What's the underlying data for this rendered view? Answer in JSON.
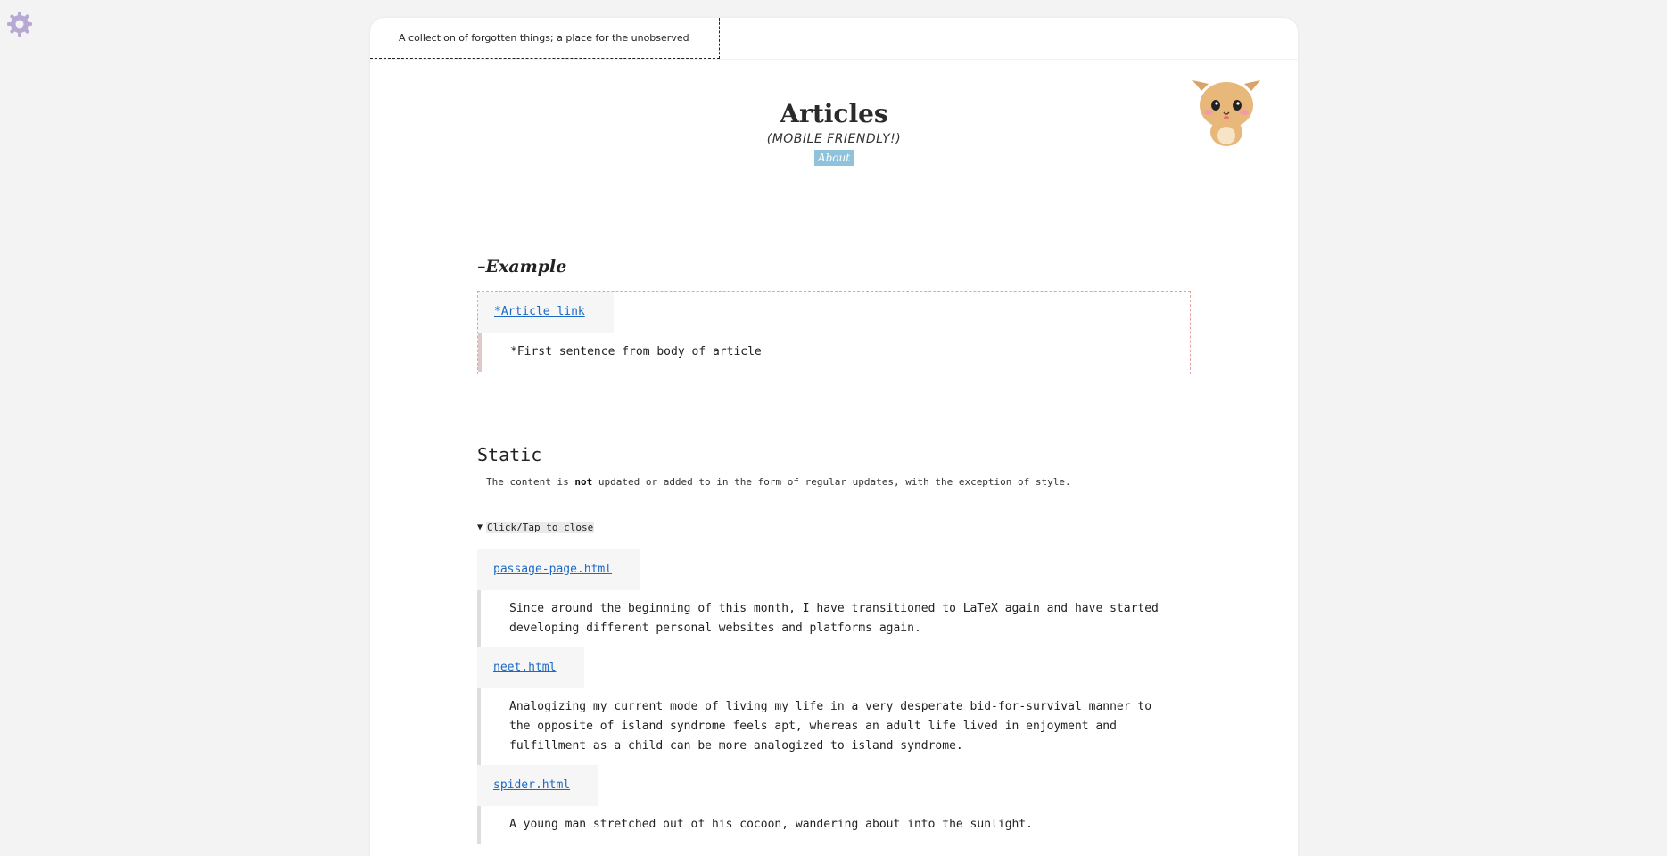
{
  "tagline": "A collection of forgotten things; a place for the unobserved",
  "header": {
    "title": "Articles",
    "subtitle": "(MOBILE FRIENDLY!)",
    "about_label": "About"
  },
  "example": {
    "heading": "–Example",
    "link_label": "*Article link",
    "first_sentence": "*First sentence from body of article"
  },
  "static": {
    "heading": "Static",
    "desc_before": "The content is",
    "desc_bold": "not",
    "desc_after": "updated or added to in the form of regular updates, with the exception of style.",
    "toggle_label": "Click/Tap to close"
  },
  "articles": [
    {
      "link": "passage-page.html",
      "excerpt": "Since around the beginning of this month, I have transitioned to LaTeX again and have started developing different personal websites and platforms again."
    },
    {
      "link": "neet.html",
      "excerpt": "Analogizing my current mode of living my life in a very desperate bid-for-survival manner to the opposite of island syndrome feels apt, whereas an adult life lived in enjoyment and fulfillment as a child can be more analogized to island syndrome."
    },
    {
      "link": "spider.html",
      "excerpt": "A young man stretched out of his cocoon, wandering about into the sunlight."
    }
  ],
  "colors": {
    "background": "#f3f3f3",
    "link": "#1d6ac4",
    "about_bg": "#8fc3dc",
    "example_border": "#e7a3a3"
  }
}
